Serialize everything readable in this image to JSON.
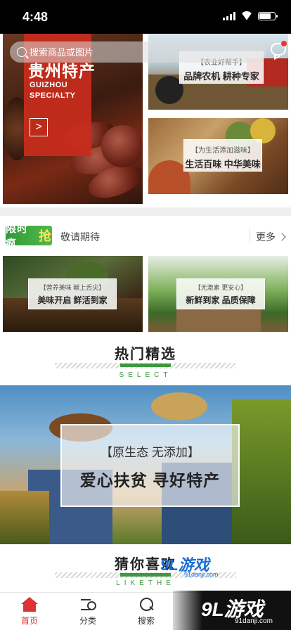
{
  "status_bar": {
    "time": "4:48"
  },
  "search": {
    "placeholder": "搜索商品或图片"
  },
  "banners": {
    "left": {
      "title_cn": "贵州特产",
      "title_en_line1": "GUIZHOU",
      "title_en_line2": "SPECIALTY",
      "arrow": ">"
    },
    "right_top": {
      "small": "【农业好帮手】",
      "big": "品牌农机  耕种专家"
    },
    "right_bottom": {
      "small": "【为生活添加滋味】",
      "big": "生活百味  中华美味"
    }
  },
  "flash_sale": {
    "logo_text": "限时疯",
    "logo_char": "抢",
    "text": "敬请期待",
    "more": "更多"
  },
  "promos": {
    "left": {
      "small": "【营养美味 献上舌尖】",
      "big": "美味开启  鲜活到家"
    },
    "right": {
      "small": "【无激素 更安心】",
      "big": "新鲜到家  品质保障"
    }
  },
  "sections": {
    "hot": {
      "title": "热门精选",
      "sub": "SELECT"
    },
    "guess": {
      "title": "猜你喜欢",
      "sub": "LIKETHE"
    }
  },
  "hero": {
    "small": "【原生态  无添加】",
    "big": "爱心扶贫  寻好特产"
  },
  "tabbar": {
    "items": [
      {
        "label": "首页"
      },
      {
        "label": "分类"
      },
      {
        "label": "搜索"
      }
    ]
  },
  "watermarks": {
    "mid": "9L游戏",
    "mid_sub": "91danji.com",
    "corner": "9L游戏",
    "corner_sub": "91danji.com"
  },
  "colors": {
    "accent_green": "#3b9a3e",
    "brand_red": "#c82c1c",
    "active_tab": "#d33333"
  }
}
